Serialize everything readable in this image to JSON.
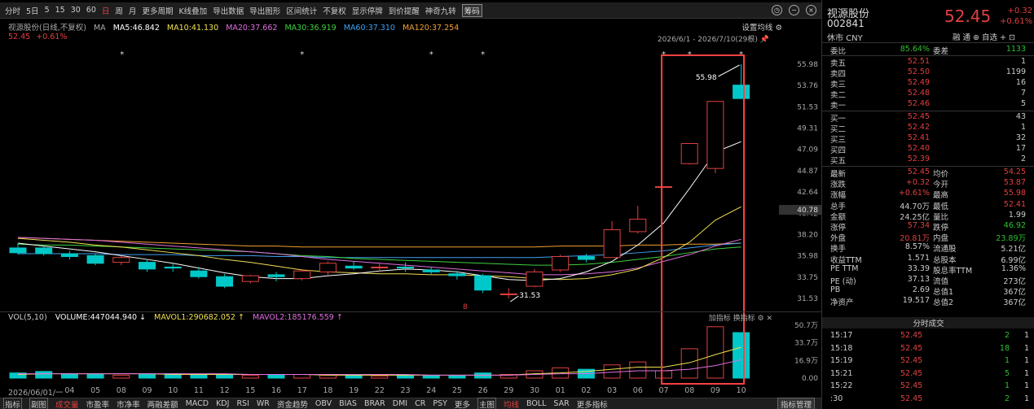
{
  "toolbar": {
    "items": [
      "分时",
      "5日",
      "5",
      "15",
      "30",
      "60",
      "日",
      "周",
      "月",
      "更多周期",
      "K线叠加",
      "导出数据",
      "导出图形",
      "区间统计",
      "不复权",
      "显示停牌",
      "到价提醒",
      "神奇九转",
      "筹码"
    ],
    "more_icons": [
      "clock-icon",
      "minimize-icon",
      "close-icon"
    ]
  },
  "ma_legend": {
    "title": "视源股份(日线,不复权)",
    "ma": "MA",
    "ma5": "MA5:46.842",
    "ma10": "MA10:41.130",
    "ma20": "MA20:37.662",
    "ma30": "MA30:36.919",
    "ma60": "MA60:37.310",
    "ma120": "MA120:37.254",
    "set_ma": "设置均线"
  },
  "price_line": {
    "price": "52.45",
    "change": "+0.61%"
  },
  "date_range": "2026/6/1 - 2026/7/10(29根)",
  "colors": {
    "up": "#e04040",
    "down": "#00c8c8",
    "ma5": "#ffffff",
    "ma10": "#f0e050",
    "ma20": "#e070e0",
    "ma30": "#40d040",
    "ma60": "#40a0f0",
    "ma120": "#f0a030",
    "highlight": "#ff4040"
  },
  "chart_data": {
    "type": "candlestick",
    "price_axis": {
      "labels": [
        "55.98",
        "53.76",
        "51.53",
        "49.31",
        "47.09",
        "44.87",
        "42.64",
        "40.42",
        "38.20",
        "35.98",
        "33.75",
        "31.53"
      ],
      "current_label": "40.78"
    },
    "high_label": "55.98",
    "low_label": "31.53",
    "x_labels": [
      "2026/06/01/一",
      "04",
      "05",
      "08",
      "09",
      "10",
      "11",
      "12",
      "15",
      "16",
      "17",
      "18",
      "19",
      "22",
      "23",
      "24",
      "25",
      "26",
      "29",
      "30",
      "01",
      "02",
      "03",
      "06",
      "07",
      "08",
      "09",
      "10"
    ],
    "candles": [
      {
        "o": 36.8,
        "c": 36.3,
        "h": 37.3,
        "l": 36.1
      },
      {
        "o": 36.8,
        "c": 36.2,
        "h": 37.0,
        "l": 36.0
      },
      {
        "o": 36.2,
        "c": 35.9,
        "h": 36.5,
        "l": 35.6
      },
      {
        "o": 36.0,
        "c": 35.2,
        "h": 36.2,
        "l": 35.0
      },
      {
        "o": 35.3,
        "c": 35.8,
        "h": 36.0,
        "l": 35.0
      },
      {
        "o": 35.3,
        "c": 34.6,
        "h": 35.6,
        "l": 34.3
      },
      {
        "o": 34.8,
        "c": 34.7,
        "h": 35.2,
        "l": 34.3
      },
      {
        "o": 34.4,
        "c": 33.8,
        "h": 34.8,
        "l": 33.6
      },
      {
        "o": 33.8,
        "c": 32.8,
        "h": 34.1,
        "l": 32.6
      },
      {
        "o": 33.3,
        "c": 33.9,
        "h": 34.0,
        "l": 33.1
      },
      {
        "o": 34.0,
        "c": 33.8,
        "h": 34.3,
        "l": 33.3
      },
      {
        "o": 33.6,
        "c": 34.4,
        "h": 34.6,
        "l": 33.4
      },
      {
        "o": 34.3,
        "c": 35.2,
        "h": 35.4,
        "l": 34.0
      },
      {
        "o": 34.9,
        "c": 34.7,
        "h": 35.4,
        "l": 34.5
      },
      {
        "o": 34.8,
        "c": 34.8,
        "h": 35.3,
        "l": 34.3
      },
      {
        "o": 34.8,
        "c": 34.7,
        "h": 35.3,
        "l": 34.3
      },
      {
        "o": 34.5,
        "c": 34.3,
        "h": 34.8,
        "l": 34.0
      },
      {
        "o": 34.1,
        "c": 33.9,
        "h": 34.4,
        "l": 33.5
      },
      {
        "o": 33.9,
        "c": 32.4,
        "h": 34.1,
        "l": 32.1
      },
      {
        "o": 32.0,
        "c": 32.0,
        "h": 32.6,
        "l": 31.53
      },
      {
        "o": 32.8,
        "c": 34.3,
        "h": 34.6,
        "l": 32.7
      },
      {
        "o": 34.5,
        "c": 35.9,
        "h": 36.1,
        "l": 34.3
      },
      {
        "o": 35.9,
        "c": 35.6,
        "h": 36.2,
        "l": 35.3
      },
      {
        "o": 35.8,
        "c": 38.7,
        "h": 39.6,
        "l": 35.8
      },
      {
        "o": 38.5,
        "c": 39.8,
        "h": 41.2,
        "l": 38.3
      },
      {
        "o": 43.2,
        "c": 43.2,
        "h": 43.2,
        "l": 43.2
      },
      {
        "o": 45.6,
        "c": 47.7,
        "h": 47.7,
        "l": 45.5
      },
      {
        "o": 45.1,
        "c": 52.1,
        "h": 52.1,
        "l": 44.6
      },
      {
        "o": 53.8,
        "c": 52.4,
        "h": 55.98,
        "l": 52.4
      }
    ],
    "ma5": [
      37.3,
      37.0,
      36.7,
      36.4,
      36.0,
      35.6,
      35.2,
      34.7,
      34.2,
      33.8,
      33.6,
      33.6,
      33.9,
      34.1,
      34.4,
      34.6,
      34.5,
      34.3,
      33.9,
      33.5,
      33.4,
      33.6,
      34.3,
      35.4,
      37.1,
      39.4,
      43.0,
      46.8,
      47.9
    ],
    "ma10": [
      37.8,
      37.6,
      37.4,
      37.1,
      36.9,
      36.6,
      36.3,
      36.0,
      35.6,
      35.3,
      34.9,
      34.5,
      34.3,
      34.2,
      34.1,
      34.1,
      34.0,
      34.0,
      33.9,
      33.8,
      33.6,
      33.5,
      33.6,
      34.0,
      34.6,
      35.8,
      37.4,
      39.7,
      41.1
    ],
    "ma20": [
      37.9,
      37.8,
      37.7,
      37.6,
      37.4,
      37.2,
      37.0,
      36.8,
      36.6,
      36.4,
      36.2,
      35.9,
      35.6,
      35.4,
      35.2,
      35.0,
      34.8,
      34.6,
      34.4,
      34.2,
      34.0,
      34.0,
      34.1,
      34.3,
      34.7,
      35.4,
      36.1,
      37.0,
      37.7
    ],
    "ma30": [
      37.2,
      37.1,
      37.1,
      37.0,
      36.9,
      36.8,
      36.7,
      36.6,
      36.5,
      36.4,
      36.2,
      36.0,
      35.9,
      35.7,
      35.6,
      35.5,
      35.4,
      35.3,
      35.2,
      35.1,
      35.0,
      35.0,
      35.1,
      35.3,
      35.6,
      35.9,
      36.3,
      36.7,
      36.9
    ],
    "ma60": [
      36.2,
      36.2,
      36.2,
      36.2,
      36.1,
      36.1,
      36.1,
      36.0,
      36.0,
      36.0,
      35.9,
      35.9,
      35.8,
      35.8,
      35.8,
      35.8,
      35.8,
      35.8,
      35.8,
      35.8,
      35.8,
      35.9,
      36.0,
      36.1,
      36.3,
      36.5,
      36.8,
      37.1,
      37.3
    ],
    "ma120": [
      37.9,
      37.8,
      37.7,
      37.6,
      37.5,
      37.4,
      37.3,
      37.2,
      37.1,
      37.0,
      37.0,
      36.9,
      36.9,
      36.9,
      36.9,
      36.9,
      36.9,
      36.9,
      36.9,
      36.9,
      36.9,
      37.0,
      37.0,
      37.0,
      37.1,
      37.1,
      37.2,
      37.2,
      37.3
    ],
    "vol_axis": {
      "labels": [
        "50.7万",
        "33.7万",
        "16.9万",
        "0.00"
      ]
    },
    "volume": [
      7,
      9,
      6,
      5,
      4,
      5,
      6,
      4,
      5,
      4,
      4,
      5,
      4,
      4,
      3,
      4,
      3,
      3,
      7,
      5,
      10,
      14,
      12,
      18,
      22,
      10,
      40,
      70,
      62
    ],
    "mavol1": [
      5,
      6,
      6,
      6,
      6,
      6,
      5,
      5,
      5,
      5,
      5,
      5,
      4,
      4,
      4,
      4,
      4,
      4,
      4,
      4,
      6,
      7,
      9,
      12,
      15,
      15,
      21,
      32,
      42
    ],
    "mavol2": [
      6,
      6,
      6,
      6,
      6,
      6,
      6,
      6,
      6,
      5,
      5,
      5,
      5,
      5,
      5,
      5,
      4,
      4,
      4,
      4,
      5,
      6,
      6,
      8,
      10,
      10,
      12,
      17,
      25
    ]
  },
  "vol_legend": {
    "title": "VOL(5,10)",
    "volume": "VOLUME:447044.940 ↓",
    "mavol1": "MAVOL1:290682.052 ↑",
    "mavol2": "MAVOL2:185176.559 ↑",
    "right": "加指标  换指标"
  },
  "bottom_tabs": [
    "指标",
    "副图",
    "成交量",
    "市盈率",
    "市净率",
    "两融差额",
    "MACD",
    "KDJ",
    "RSI",
    "WR",
    "资金趋势",
    "OBV",
    "BIAS",
    "BRAR",
    "DMI",
    "CR",
    "PSY",
    "更多",
    "主图",
    "均线",
    "BOLL",
    "SAR",
    "更多指标"
  ],
  "indicator_mgmt": "指标管理",
  "stock": {
    "name": "视源股份",
    "code": "002841",
    "currency": "休市 CNY",
    "price": "52.45",
    "change": "+0.32",
    "change_pct": "+0.61%",
    "icons": "融 通 ⊕ 自选 + ⊡"
  },
  "ratio": {
    "k1": "委比",
    "v1": "85.64%",
    "k2": "委差",
    "v2": "1133"
  },
  "asks": [
    {
      "label": "卖五",
      "price": "52.51",
      "vol": "1"
    },
    {
      "label": "卖四",
      "price": "52.50",
      "vol": "1199"
    },
    {
      "label": "卖三",
      "price": "52.49",
      "vol": "16"
    },
    {
      "label": "卖二",
      "price": "52.48",
      "vol": "7"
    },
    {
      "label": "卖一",
      "price": "52.46",
      "vol": "5"
    }
  ],
  "bids": [
    {
      "label": "买一",
      "price": "52.45",
      "vol": "43"
    },
    {
      "label": "买二",
      "price": "52.42",
      "vol": "1"
    },
    {
      "label": "买三",
      "price": "52.41",
      "vol": "32"
    },
    {
      "label": "买四",
      "price": "52.40",
      "vol": "17"
    },
    {
      "label": "买五",
      "price": "52.39",
      "vol": "2"
    }
  ],
  "stats": [
    {
      "k1": "最新",
      "v1": "52.45",
      "c1": "red",
      "k2": "均价",
      "v2": "54.25",
      "c2": "red"
    },
    {
      "k1": "涨跌",
      "v1": "+0.32",
      "c1": "red",
      "k2": "今开",
      "v2": "53.87",
      "c2": "red"
    },
    {
      "k1": "涨幅",
      "v1": "+0.61%",
      "c1": "red",
      "k2": "最高",
      "v2": "55.98",
      "c2": "red"
    },
    {
      "k1": "总手",
      "v1": "44.70万",
      "c1": "wht",
      "k2": "最低",
      "v2": "52.41",
      "c2": "red"
    },
    {
      "k1": "金额",
      "v1": "24.25亿",
      "c1": "wht",
      "k2": "量比",
      "v2": "1.99",
      "c2": "wht"
    },
    {
      "k1": "涨停",
      "v1": "57.34",
      "c1": "red",
      "k2": "跌停",
      "v2": "46.92",
      "c2": "green"
    },
    {
      "k1": "外盘",
      "v1": "20.81万",
      "c1": "red",
      "k2": "内盘",
      "v2": "23.89万",
      "c2": "green"
    },
    {
      "k1": "换手",
      "v1": "8.57%",
      "c1": "wht",
      "k2": "流通股",
      "v2": "5.21亿",
      "c2": "wht"
    },
    {
      "k1": "收益TTM",
      "v1": "1.571",
      "c1": "wht",
      "k2": "总股本",
      "v2": "6.99亿",
      "c2": "wht"
    },
    {
      "k1": "PE TTM",
      "v1": "33.39",
      "c1": "wht",
      "k2": "股息率TTM",
      "v2": "1.36%",
      "c2": "wht"
    },
    {
      "k1": "PE (动)",
      "v1": "37.13",
      "c1": "wht",
      "k2": "流值",
      "v2": "273亿",
      "c2": "wht"
    },
    {
      "k1": "PB",
      "v1": "2.69",
      "c1": "wht",
      "k2": "总值1",
      "v2": "367亿",
      "c2": "wht"
    },
    {
      "k1": "净资产",
      "v1": "19.517",
      "c1": "wht",
      "k2": "总值2",
      "v2": "367亿",
      "c2": "wht"
    }
  ],
  "trades_title": "分时成交",
  "trades": [
    {
      "t": "15:17",
      "p": "52.45",
      "v": "2",
      "n": "1"
    },
    {
      "t": "15:18",
      "p": "52.45",
      "v": "18",
      "n": "1"
    },
    {
      "t": "15:19",
      "p": "52.45",
      "v": "1",
      "n": "1"
    },
    {
      "t": "15:21",
      "p": "52.45",
      "v": "5",
      "n": "1"
    },
    {
      "t": "15:22",
      "p": "52.45",
      "v": "1",
      "n": "1"
    },
    {
      "t": ":30",
      "p": "52.45",
      "v": "2",
      "n": "1"
    }
  ]
}
